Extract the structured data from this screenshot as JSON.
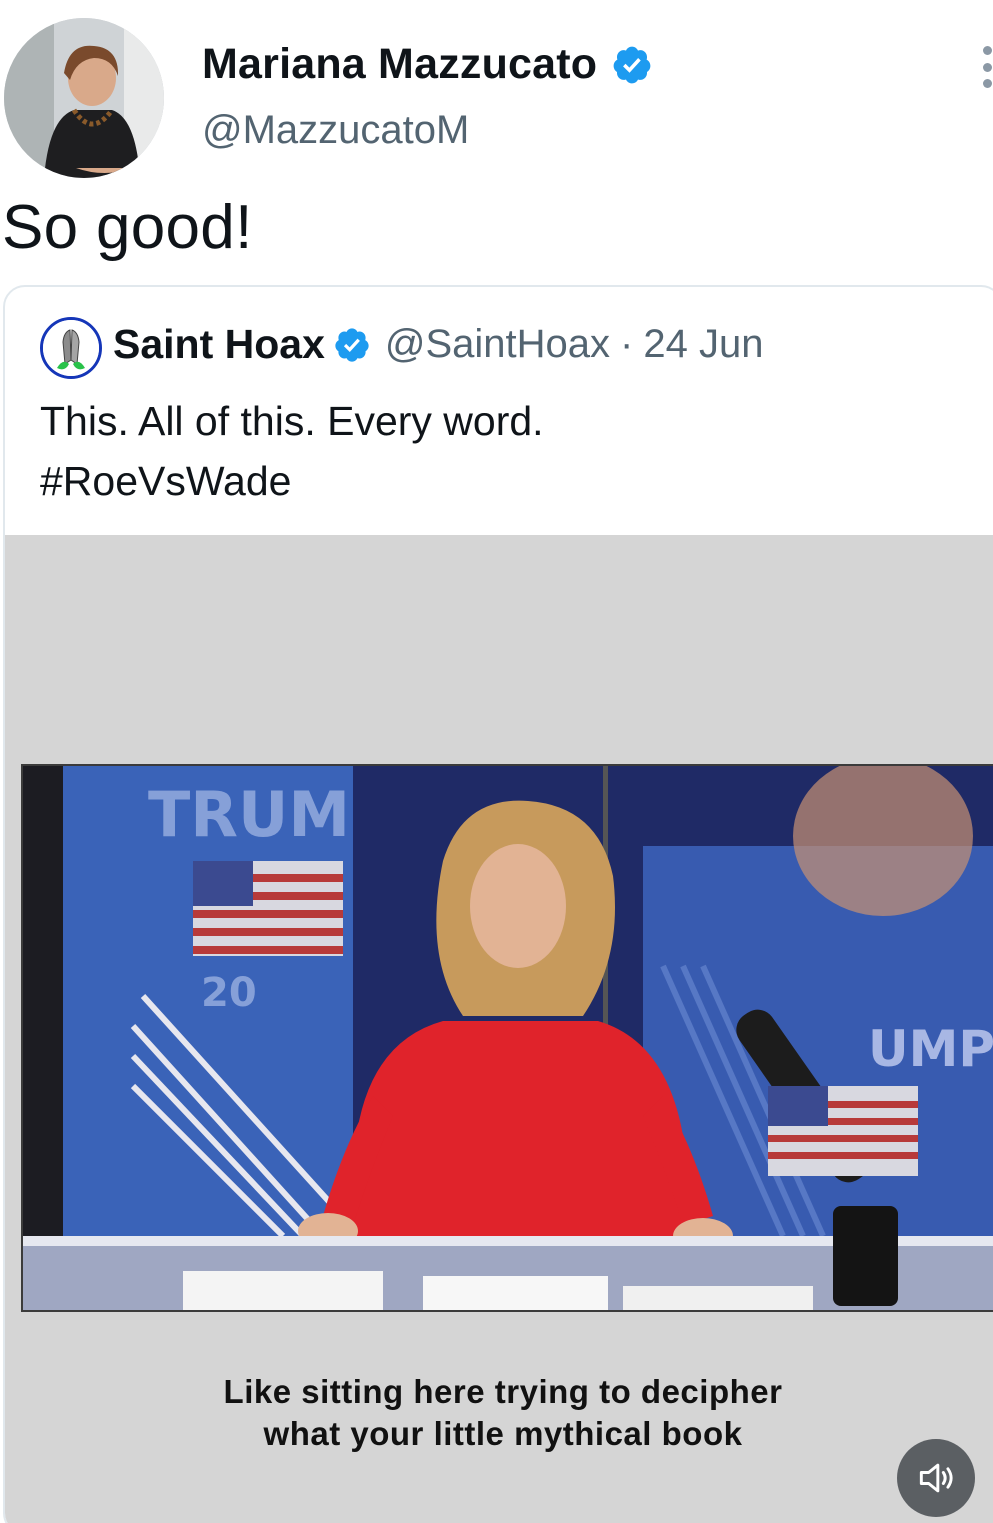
{
  "author": {
    "name": "Mariana Mazzucato",
    "handle": "@MazzucatoM",
    "avatar_icon": "profile-photo"
  },
  "tweet": {
    "text": "So good!"
  },
  "quoted_tweet": {
    "name": "Saint Hoax",
    "handle": "@SaintHoax",
    "separator": "·",
    "date": "24 Jun",
    "text_line1": "This. All of this. Every word.",
    "text_line2": "#RoeVsWade",
    "avatar_icon": "praying-hands-icon"
  },
  "video": {
    "caption_line1": "Like sitting here trying to decipher",
    "caption_line2": "what your little mythical book",
    "background_text_left": "TRUM",
    "background_text_left_2": "20",
    "background_text_right": "UMP"
  },
  "colors": {
    "verified": "#1d9bf0",
    "text_primary": "#0f1419",
    "text_secondary": "#536471",
    "video_bg": "#d5d5d5"
  }
}
